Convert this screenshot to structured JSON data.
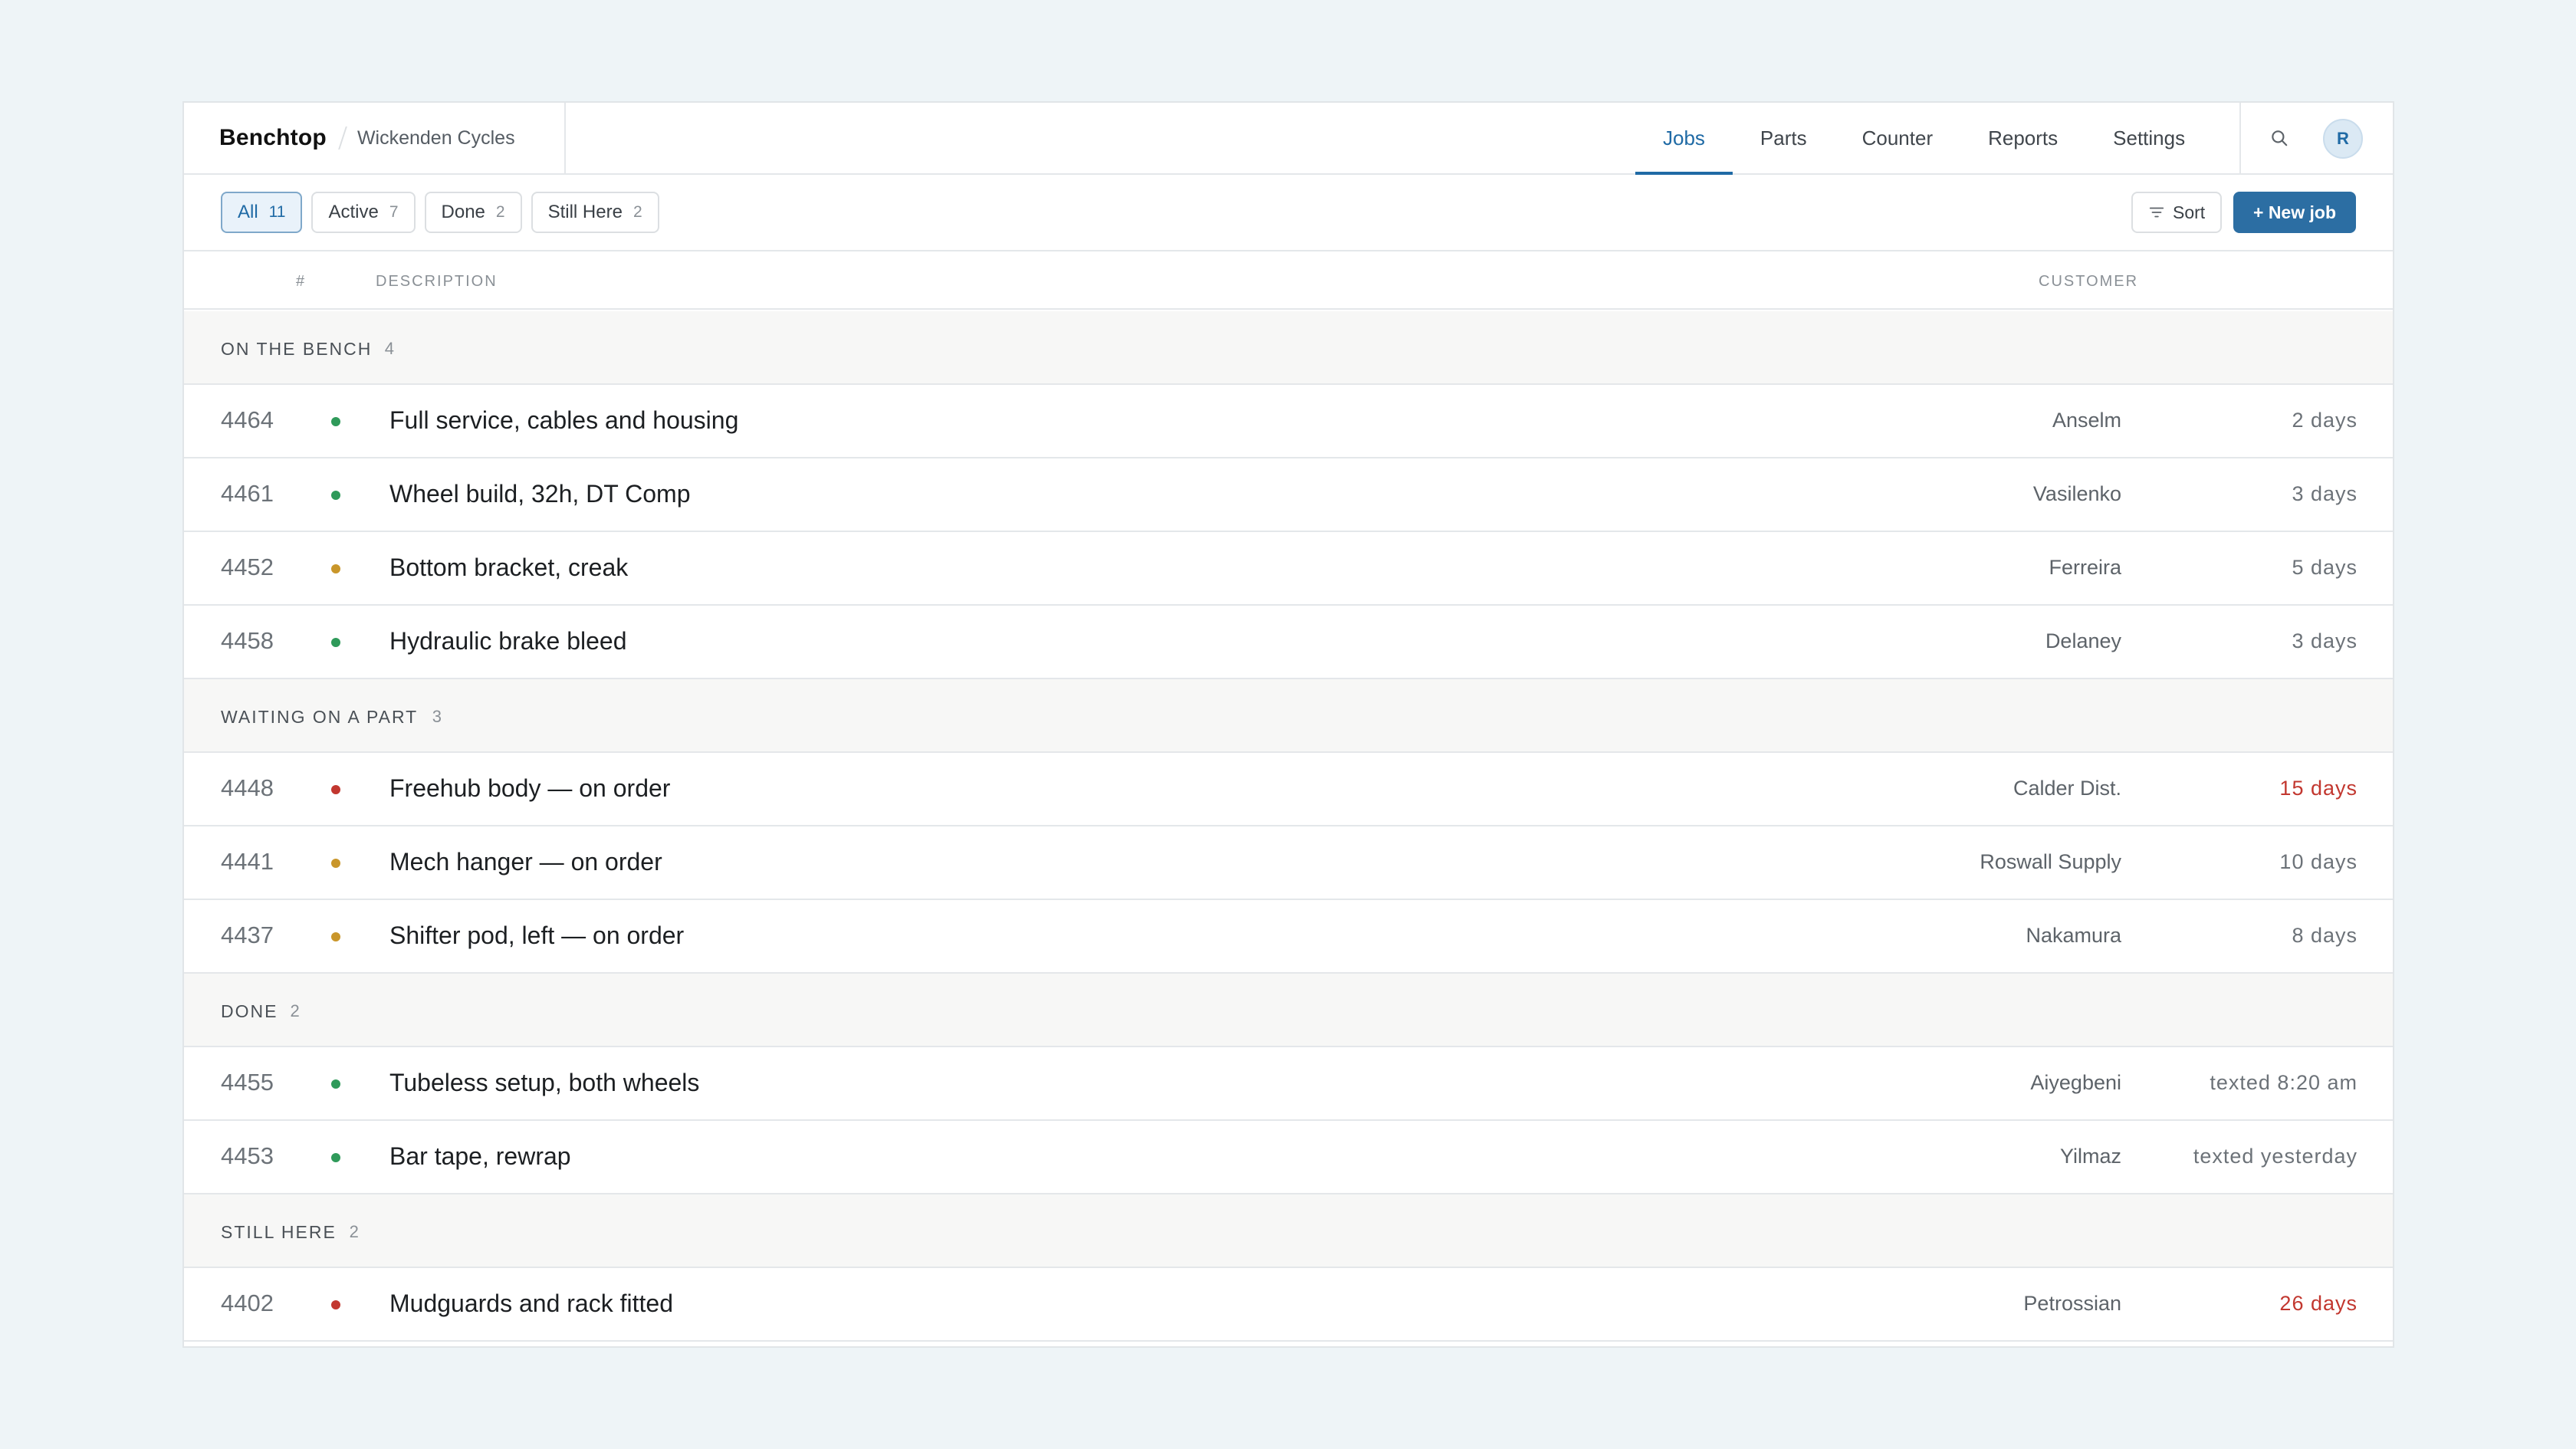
{
  "app": {
    "name": "Benchtop",
    "shop": "Wickenden Cycles",
    "avatar_initial": "R"
  },
  "nav": {
    "tabs": [
      "Jobs",
      "Parts",
      "Counter",
      "Reports",
      "Settings"
    ],
    "active": "Jobs"
  },
  "filters": {
    "chips": [
      {
        "label": "All",
        "count": "11",
        "active": true
      },
      {
        "label": "Active",
        "count": "7",
        "active": false
      },
      {
        "label": "Done",
        "count": "2",
        "active": false
      },
      {
        "label": "Still Here",
        "count": "2",
        "active": false
      }
    ],
    "sort_label": "Sort",
    "new_job_label": "+ New job"
  },
  "table": {
    "headers": {
      "num": "#",
      "description": "DESCRIPTION",
      "customer": "CUSTOMER"
    },
    "colors": {
      "green": "#2f9a5a",
      "amber": "#c9962a",
      "red": "#c2372f"
    },
    "groups": [
      {
        "label": "ON THE BENCH",
        "count": "4",
        "rows": [
          {
            "num": "4464",
            "status": "green",
            "desc": "Full service, cables and housing",
            "customer": "Anselm",
            "age": "2 days",
            "overdue": false
          },
          {
            "num": "4461",
            "status": "green",
            "desc": "Wheel build, 32h, DT Comp",
            "customer": "Vasilenko",
            "age": "3 days",
            "overdue": false
          },
          {
            "num": "4452",
            "status": "amber",
            "desc": "Bottom bracket, creak",
            "customer": "Ferreira",
            "age": "5 days",
            "overdue": false
          },
          {
            "num": "4458",
            "status": "green",
            "desc": "Hydraulic brake bleed",
            "customer": "Delaney",
            "age": "3 days",
            "overdue": false
          }
        ]
      },
      {
        "label": "WAITING ON A PART",
        "count": "3",
        "rows": [
          {
            "num": "4448",
            "status": "red",
            "desc": "Freehub body — on order",
            "customer": "Calder Dist.",
            "age": "15 days",
            "overdue": true
          },
          {
            "num": "4441",
            "status": "amber",
            "desc": "Mech hanger — on order",
            "customer": "Roswall Supply",
            "age": "10 days",
            "overdue": false
          },
          {
            "num": "4437",
            "status": "amber",
            "desc": "Shifter pod, left — on order",
            "customer": "Nakamura",
            "age": "8 days",
            "overdue": false
          }
        ]
      },
      {
        "label": "DONE",
        "count": "2",
        "rows": [
          {
            "num": "4455",
            "status": "green",
            "desc": "Tubeless setup, both wheels",
            "customer": "Aiyegbeni",
            "age": "texted 8:20 am",
            "overdue": false
          },
          {
            "num": "4453",
            "status": "green",
            "desc": "Bar tape, rewrap",
            "customer": "Yilmaz",
            "age": "texted yesterday",
            "overdue": false
          }
        ]
      },
      {
        "label": "STILL HERE",
        "count": "2",
        "rows": [
          {
            "num": "4402",
            "status": "red",
            "desc": "Mudguards and rack fitted",
            "customer": "Petrossian",
            "age": "26 days",
            "overdue": true
          }
        ]
      }
    ]
  }
}
